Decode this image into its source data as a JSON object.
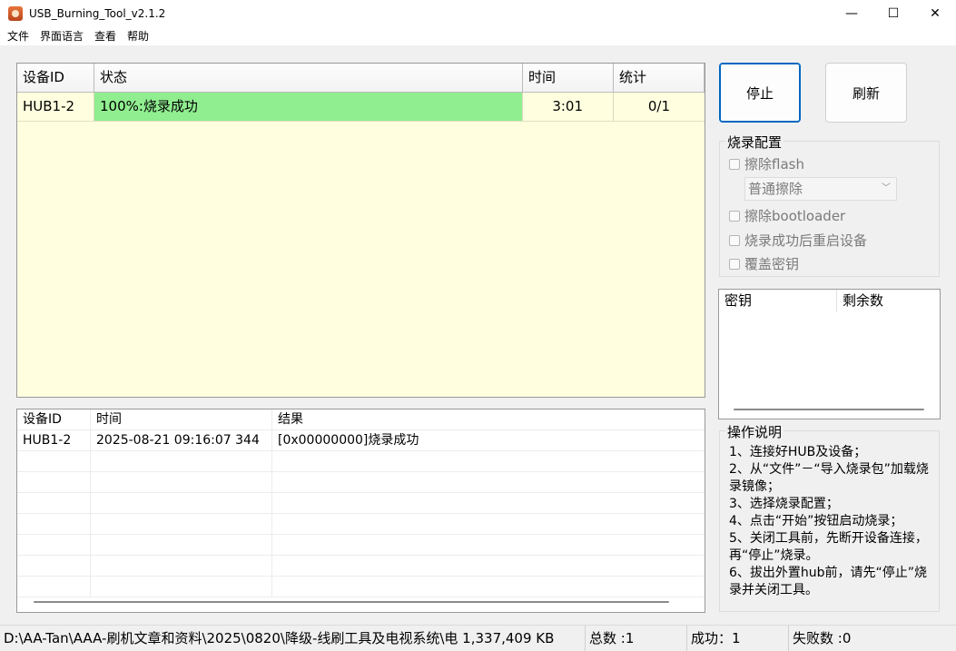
{
  "window": {
    "title": "USB_Burning_Tool_v2.1.2",
    "minimize": "—",
    "maximize": "☐",
    "close": "✕"
  },
  "menu": [
    "文件",
    "界面语言",
    "查看",
    "帮助"
  ],
  "device_table": {
    "headers": {
      "id": "设备ID",
      "status": "状态",
      "time": "时间",
      "stat": "统计"
    },
    "rows": [
      {
        "id": "HUB1-2",
        "status": "100%:烧录成功",
        "time": "3:01",
        "stat": "0/1",
        "status_color": "#90ee90"
      }
    ]
  },
  "log_table": {
    "headers": {
      "id": "设备ID",
      "time": "时间",
      "result": "结果"
    },
    "rows": [
      {
        "id": "HUB1-2",
        "time": "2025-08-21 09:16:07 344",
        "result": "[0x00000000]烧录成功"
      }
    ]
  },
  "buttons": {
    "stop": "停止",
    "refresh": "刷新"
  },
  "burn_config": {
    "title": "烧录配置",
    "erase_flash": "擦除flash",
    "erase_mode": "普通擦除",
    "erase_bootloader": "擦除bootloader",
    "reboot_after": "烧录成功后重启设备",
    "overwrite_key": "覆盖密钥"
  },
  "key_table": {
    "headers": {
      "key": "密钥",
      "remaining": "剩余数"
    }
  },
  "instructions": {
    "title": "操作说明",
    "text": "1、连接好HUB及设备；\n2、从“文件”－“导入烧录包”加载烧录镜像；\n3、选择烧录配置；\n4、点击“开始”按钮启动烧录；\n5、关闭工具前，先断开设备连接，再“停止”烧录。\n6、拔出外置hub前，请先“停止”烧录并关闭工具。"
  },
  "statusbar": {
    "path": "D:\\AA-Tan\\AAA-刷机文章和资料\\2025\\0820\\降级-线刷工具及电视系统\\电 1,337,409 KB",
    "total": "总数 :1",
    "success": "成功：1",
    "fail": "失败数 :0"
  }
}
